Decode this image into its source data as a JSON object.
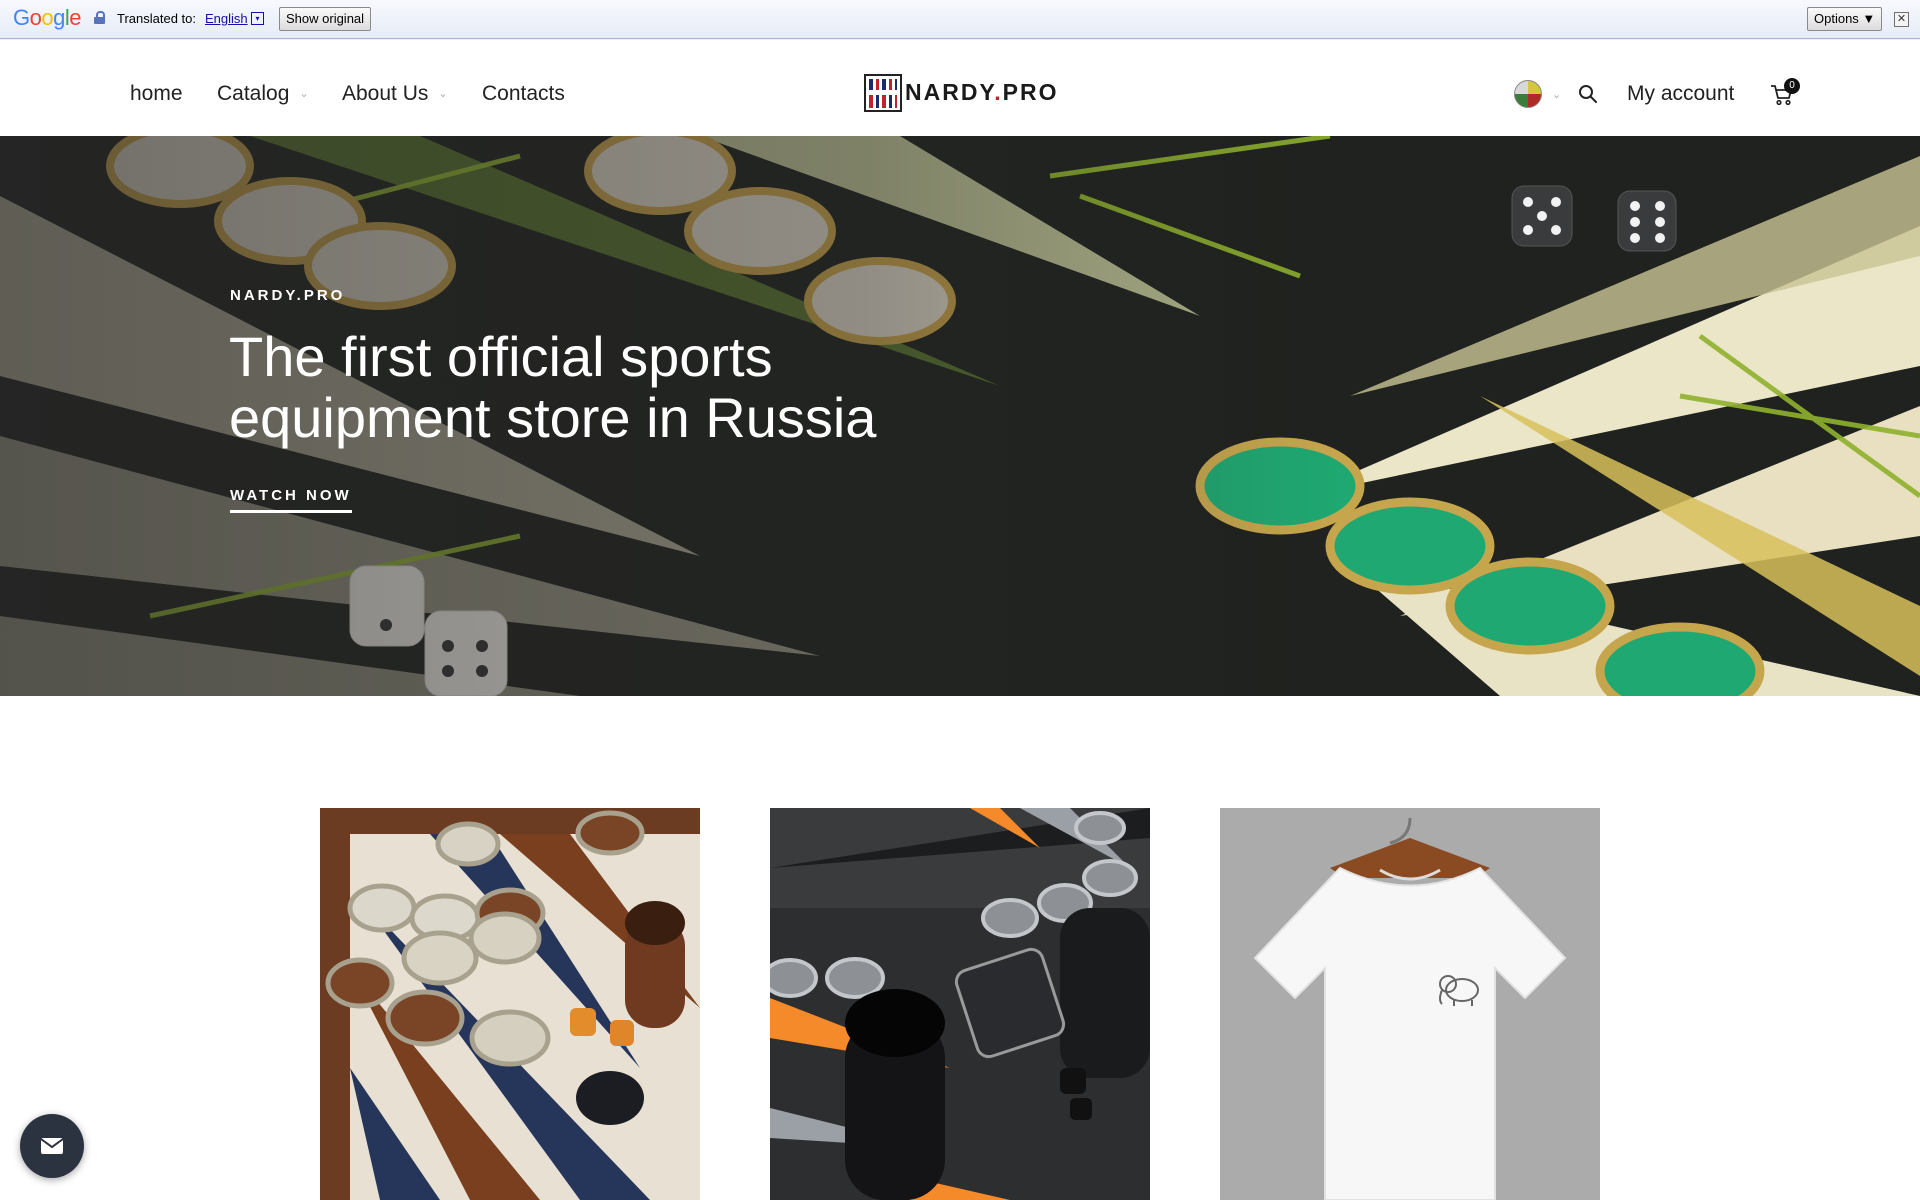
{
  "translate_bar": {
    "logo_text": "Google",
    "translated_label": "Translated to:",
    "language": "English",
    "language_arrow": "▾",
    "show_original": "Show original",
    "options": "Options ▼",
    "close": "✕"
  },
  "header": {
    "nav": [
      {
        "label": "home",
        "has_dropdown": false
      },
      {
        "label": "Catalog",
        "has_dropdown": true
      },
      {
        "label": "About Us",
        "has_dropdown": true
      },
      {
        "label": "Contacts",
        "has_dropdown": false
      }
    ],
    "dropdown_chevron": "⌄",
    "logo": {
      "text_main": "NARDY",
      "text_dot": ".",
      "text_tail": "PRO"
    },
    "account_label": "My account",
    "cart_count": "0",
    "icons": [
      "flag-icon",
      "search-icon",
      "cart-icon"
    ]
  },
  "hero": {
    "kicker": "NARDY.PRO",
    "title": "The first official sports equipment store in Russia",
    "cta": "WATCH NOW"
  },
  "products": [
    {
      "image": "brown-backgammon-board-image"
    },
    {
      "image": "black-backgammon-board-image"
    },
    {
      "image": "white-tshirt-elephant-image"
    }
  ],
  "mail_button": {
    "icon": "mail-icon"
  },
  "colors": {
    "accent_red": "#c0232c",
    "logo_blue": "#1b2a6b",
    "hero_dark": "#20231f",
    "mail_button": "#2c3340"
  }
}
